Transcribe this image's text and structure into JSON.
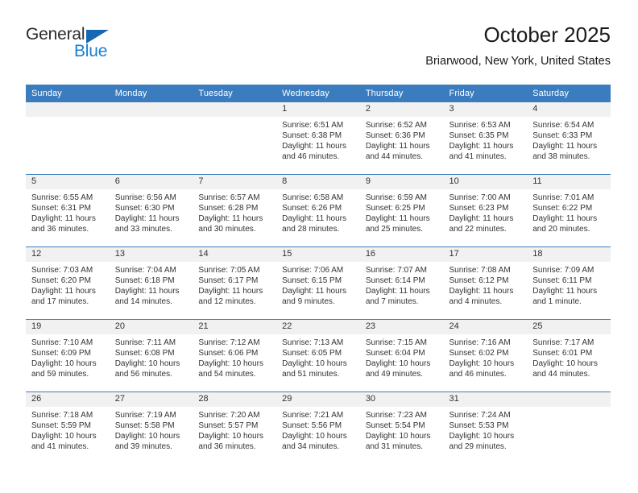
{
  "brand": {
    "word1": "General",
    "word2": "Blue",
    "triangle_color": "#1668b3",
    "blue_color": "#1a7fd4"
  },
  "header": {
    "title": "October 2025",
    "location": "Briarwood, New York, United States"
  },
  "theme": {
    "header_row_bg": "#3a7cbe",
    "daynum_band_bg": "#f1f1f1",
    "row_divider": "#3a7cbe",
    "text": "#333333"
  },
  "weekday_headers": [
    "Sunday",
    "Monday",
    "Tuesday",
    "Wednesday",
    "Thursday",
    "Friday",
    "Saturday"
  ],
  "labels": {
    "sunrise_prefix": "Sunrise:",
    "sunset_prefix": "Sunset:",
    "daylight_prefix": "Daylight:"
  },
  "weeks": [
    [
      {
        "day": "",
        "sunrise": "",
        "sunset": "",
        "daylight_line1": "",
        "daylight_line2": "",
        "empty": true
      },
      {
        "day": "",
        "sunrise": "",
        "sunset": "",
        "daylight_line1": "",
        "daylight_line2": "",
        "empty": true
      },
      {
        "day": "",
        "sunrise": "",
        "sunset": "",
        "daylight_line1": "",
        "daylight_line2": "",
        "empty": true
      },
      {
        "day": "1",
        "sunrise": "Sunrise: 6:51 AM",
        "sunset": "Sunset: 6:38 PM",
        "daylight_line1": "Daylight: 11 hours",
        "daylight_line2": "and 46 minutes.",
        "empty": false
      },
      {
        "day": "2",
        "sunrise": "Sunrise: 6:52 AM",
        "sunset": "Sunset: 6:36 PM",
        "daylight_line1": "Daylight: 11 hours",
        "daylight_line2": "and 44 minutes.",
        "empty": false
      },
      {
        "day": "3",
        "sunrise": "Sunrise: 6:53 AM",
        "sunset": "Sunset: 6:35 PM",
        "daylight_line1": "Daylight: 11 hours",
        "daylight_line2": "and 41 minutes.",
        "empty": false
      },
      {
        "day": "4",
        "sunrise": "Sunrise: 6:54 AM",
        "sunset": "Sunset: 6:33 PM",
        "daylight_line1": "Daylight: 11 hours",
        "daylight_line2": "and 38 minutes.",
        "empty": false
      }
    ],
    [
      {
        "day": "5",
        "sunrise": "Sunrise: 6:55 AM",
        "sunset": "Sunset: 6:31 PM",
        "daylight_line1": "Daylight: 11 hours",
        "daylight_line2": "and 36 minutes.",
        "empty": false
      },
      {
        "day": "6",
        "sunrise": "Sunrise: 6:56 AM",
        "sunset": "Sunset: 6:30 PM",
        "daylight_line1": "Daylight: 11 hours",
        "daylight_line2": "and 33 minutes.",
        "empty": false
      },
      {
        "day": "7",
        "sunrise": "Sunrise: 6:57 AM",
        "sunset": "Sunset: 6:28 PM",
        "daylight_line1": "Daylight: 11 hours",
        "daylight_line2": "and 30 minutes.",
        "empty": false
      },
      {
        "day": "8",
        "sunrise": "Sunrise: 6:58 AM",
        "sunset": "Sunset: 6:26 PM",
        "daylight_line1": "Daylight: 11 hours",
        "daylight_line2": "and 28 minutes.",
        "empty": false
      },
      {
        "day": "9",
        "sunrise": "Sunrise: 6:59 AM",
        "sunset": "Sunset: 6:25 PM",
        "daylight_line1": "Daylight: 11 hours",
        "daylight_line2": "and 25 minutes.",
        "empty": false
      },
      {
        "day": "10",
        "sunrise": "Sunrise: 7:00 AM",
        "sunset": "Sunset: 6:23 PM",
        "daylight_line1": "Daylight: 11 hours",
        "daylight_line2": "and 22 minutes.",
        "empty": false
      },
      {
        "day": "11",
        "sunrise": "Sunrise: 7:01 AM",
        "sunset": "Sunset: 6:22 PM",
        "daylight_line1": "Daylight: 11 hours",
        "daylight_line2": "and 20 minutes.",
        "empty": false
      }
    ],
    [
      {
        "day": "12",
        "sunrise": "Sunrise: 7:03 AM",
        "sunset": "Sunset: 6:20 PM",
        "daylight_line1": "Daylight: 11 hours",
        "daylight_line2": "and 17 minutes.",
        "empty": false
      },
      {
        "day": "13",
        "sunrise": "Sunrise: 7:04 AM",
        "sunset": "Sunset: 6:18 PM",
        "daylight_line1": "Daylight: 11 hours",
        "daylight_line2": "and 14 minutes.",
        "empty": false
      },
      {
        "day": "14",
        "sunrise": "Sunrise: 7:05 AM",
        "sunset": "Sunset: 6:17 PM",
        "daylight_line1": "Daylight: 11 hours",
        "daylight_line2": "and 12 minutes.",
        "empty": false
      },
      {
        "day": "15",
        "sunrise": "Sunrise: 7:06 AM",
        "sunset": "Sunset: 6:15 PM",
        "daylight_line1": "Daylight: 11 hours",
        "daylight_line2": "and 9 minutes.",
        "empty": false
      },
      {
        "day": "16",
        "sunrise": "Sunrise: 7:07 AM",
        "sunset": "Sunset: 6:14 PM",
        "daylight_line1": "Daylight: 11 hours",
        "daylight_line2": "and 7 minutes.",
        "empty": false
      },
      {
        "day": "17",
        "sunrise": "Sunrise: 7:08 AM",
        "sunset": "Sunset: 6:12 PM",
        "daylight_line1": "Daylight: 11 hours",
        "daylight_line2": "and 4 minutes.",
        "empty": false
      },
      {
        "day": "18",
        "sunrise": "Sunrise: 7:09 AM",
        "sunset": "Sunset: 6:11 PM",
        "daylight_line1": "Daylight: 11 hours",
        "daylight_line2": "and 1 minute.",
        "empty": false
      }
    ],
    [
      {
        "day": "19",
        "sunrise": "Sunrise: 7:10 AM",
        "sunset": "Sunset: 6:09 PM",
        "daylight_line1": "Daylight: 10 hours",
        "daylight_line2": "and 59 minutes.",
        "empty": false
      },
      {
        "day": "20",
        "sunrise": "Sunrise: 7:11 AM",
        "sunset": "Sunset: 6:08 PM",
        "daylight_line1": "Daylight: 10 hours",
        "daylight_line2": "and 56 minutes.",
        "empty": false
      },
      {
        "day": "21",
        "sunrise": "Sunrise: 7:12 AM",
        "sunset": "Sunset: 6:06 PM",
        "daylight_line1": "Daylight: 10 hours",
        "daylight_line2": "and 54 minutes.",
        "empty": false
      },
      {
        "day": "22",
        "sunrise": "Sunrise: 7:13 AM",
        "sunset": "Sunset: 6:05 PM",
        "daylight_line1": "Daylight: 10 hours",
        "daylight_line2": "and 51 minutes.",
        "empty": false
      },
      {
        "day": "23",
        "sunrise": "Sunrise: 7:15 AM",
        "sunset": "Sunset: 6:04 PM",
        "daylight_line1": "Daylight: 10 hours",
        "daylight_line2": "and 49 minutes.",
        "empty": false
      },
      {
        "day": "24",
        "sunrise": "Sunrise: 7:16 AM",
        "sunset": "Sunset: 6:02 PM",
        "daylight_line1": "Daylight: 10 hours",
        "daylight_line2": "and 46 minutes.",
        "empty": false
      },
      {
        "day": "25",
        "sunrise": "Sunrise: 7:17 AM",
        "sunset": "Sunset: 6:01 PM",
        "daylight_line1": "Daylight: 10 hours",
        "daylight_line2": "and 44 minutes.",
        "empty": false
      }
    ],
    [
      {
        "day": "26",
        "sunrise": "Sunrise: 7:18 AM",
        "sunset": "Sunset: 5:59 PM",
        "daylight_line1": "Daylight: 10 hours",
        "daylight_line2": "and 41 minutes.",
        "empty": false
      },
      {
        "day": "27",
        "sunrise": "Sunrise: 7:19 AM",
        "sunset": "Sunset: 5:58 PM",
        "daylight_line1": "Daylight: 10 hours",
        "daylight_line2": "and 39 minutes.",
        "empty": false
      },
      {
        "day": "28",
        "sunrise": "Sunrise: 7:20 AM",
        "sunset": "Sunset: 5:57 PM",
        "daylight_line1": "Daylight: 10 hours",
        "daylight_line2": "and 36 minutes.",
        "empty": false
      },
      {
        "day": "29",
        "sunrise": "Sunrise: 7:21 AM",
        "sunset": "Sunset: 5:56 PM",
        "daylight_line1": "Daylight: 10 hours",
        "daylight_line2": "and 34 minutes.",
        "empty": false
      },
      {
        "day": "30",
        "sunrise": "Sunrise: 7:23 AM",
        "sunset": "Sunset: 5:54 PM",
        "daylight_line1": "Daylight: 10 hours",
        "daylight_line2": "and 31 minutes.",
        "empty": false
      },
      {
        "day": "31",
        "sunrise": "Sunrise: 7:24 AM",
        "sunset": "Sunset: 5:53 PM",
        "daylight_line1": "Daylight: 10 hours",
        "daylight_line2": "and 29 minutes.",
        "empty": false
      },
      {
        "day": "",
        "sunrise": "",
        "sunset": "",
        "daylight_line1": "",
        "daylight_line2": "",
        "empty": true
      }
    ]
  ]
}
